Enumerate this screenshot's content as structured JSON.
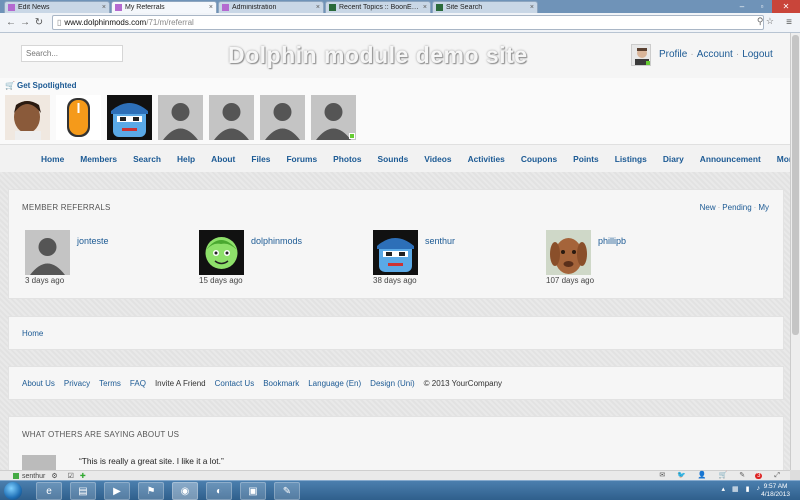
{
  "browser": {
    "tabs": [
      {
        "label": "Edit News",
        "active": false
      },
      {
        "label": "My Referrals",
        "active": true
      },
      {
        "label": "Administration",
        "active": false
      },
      {
        "label": "Recent Topics :: BoonEx U",
        "active": false
      },
      {
        "label": "Site Search",
        "active": false
      }
    ],
    "url_host": "www.dolphinmods.com",
    "url_path": "/71/m/referral"
  },
  "header": {
    "search_placeholder": "Search...",
    "site_title": "Dolphin module demo site",
    "profile_label": "Profile",
    "account_label": "Account",
    "logout_label": "Logout",
    "separator": "·"
  },
  "spotlight": {
    "title": "Get Spotlighted"
  },
  "nav": {
    "items": [
      "Home",
      "Members",
      "Search",
      "Help",
      "About",
      "Files",
      "Forums",
      "Photos",
      "Sounds",
      "Videos",
      "Activities",
      "Coupons",
      "Points",
      "Listings",
      "Diary",
      "Announcement",
      "More"
    ]
  },
  "referrals": {
    "title": "MEMBER REFERRALS",
    "tabs": [
      "New",
      "Pending",
      "My"
    ],
    "members": [
      {
        "name": "jonteste",
        "time": "3 days ago"
      },
      {
        "name": "dolphinmods",
        "time": "15 days ago"
      },
      {
        "name": "senthur",
        "time": "38 days ago"
      },
      {
        "name": "phillipb",
        "time": "107 days ago"
      }
    ]
  },
  "breadcrumb": {
    "home": "Home"
  },
  "footer": {
    "links": [
      "About Us",
      "Privacy",
      "Terms",
      "FAQ"
    ],
    "invite": "Invite A Friend",
    "links2": [
      "Contact Us",
      "Bookmark",
      "Language (En)",
      "Design (Uni)"
    ],
    "copyright": "© 2013 YourCompany"
  },
  "testimonials": {
    "title": "WHAT OTHERS ARE SAYING ABOUT US",
    "quote": "“This is really a great site. I like it a lot.”"
  },
  "chatbar": {
    "label": "senthur",
    "badge": "3"
  },
  "taskbar": {
    "time": "9:57 AM",
    "date": "4/18/2013"
  },
  "colors": {
    "link": "#1c5a94",
    "tab_bar": "#6f93b8"
  }
}
